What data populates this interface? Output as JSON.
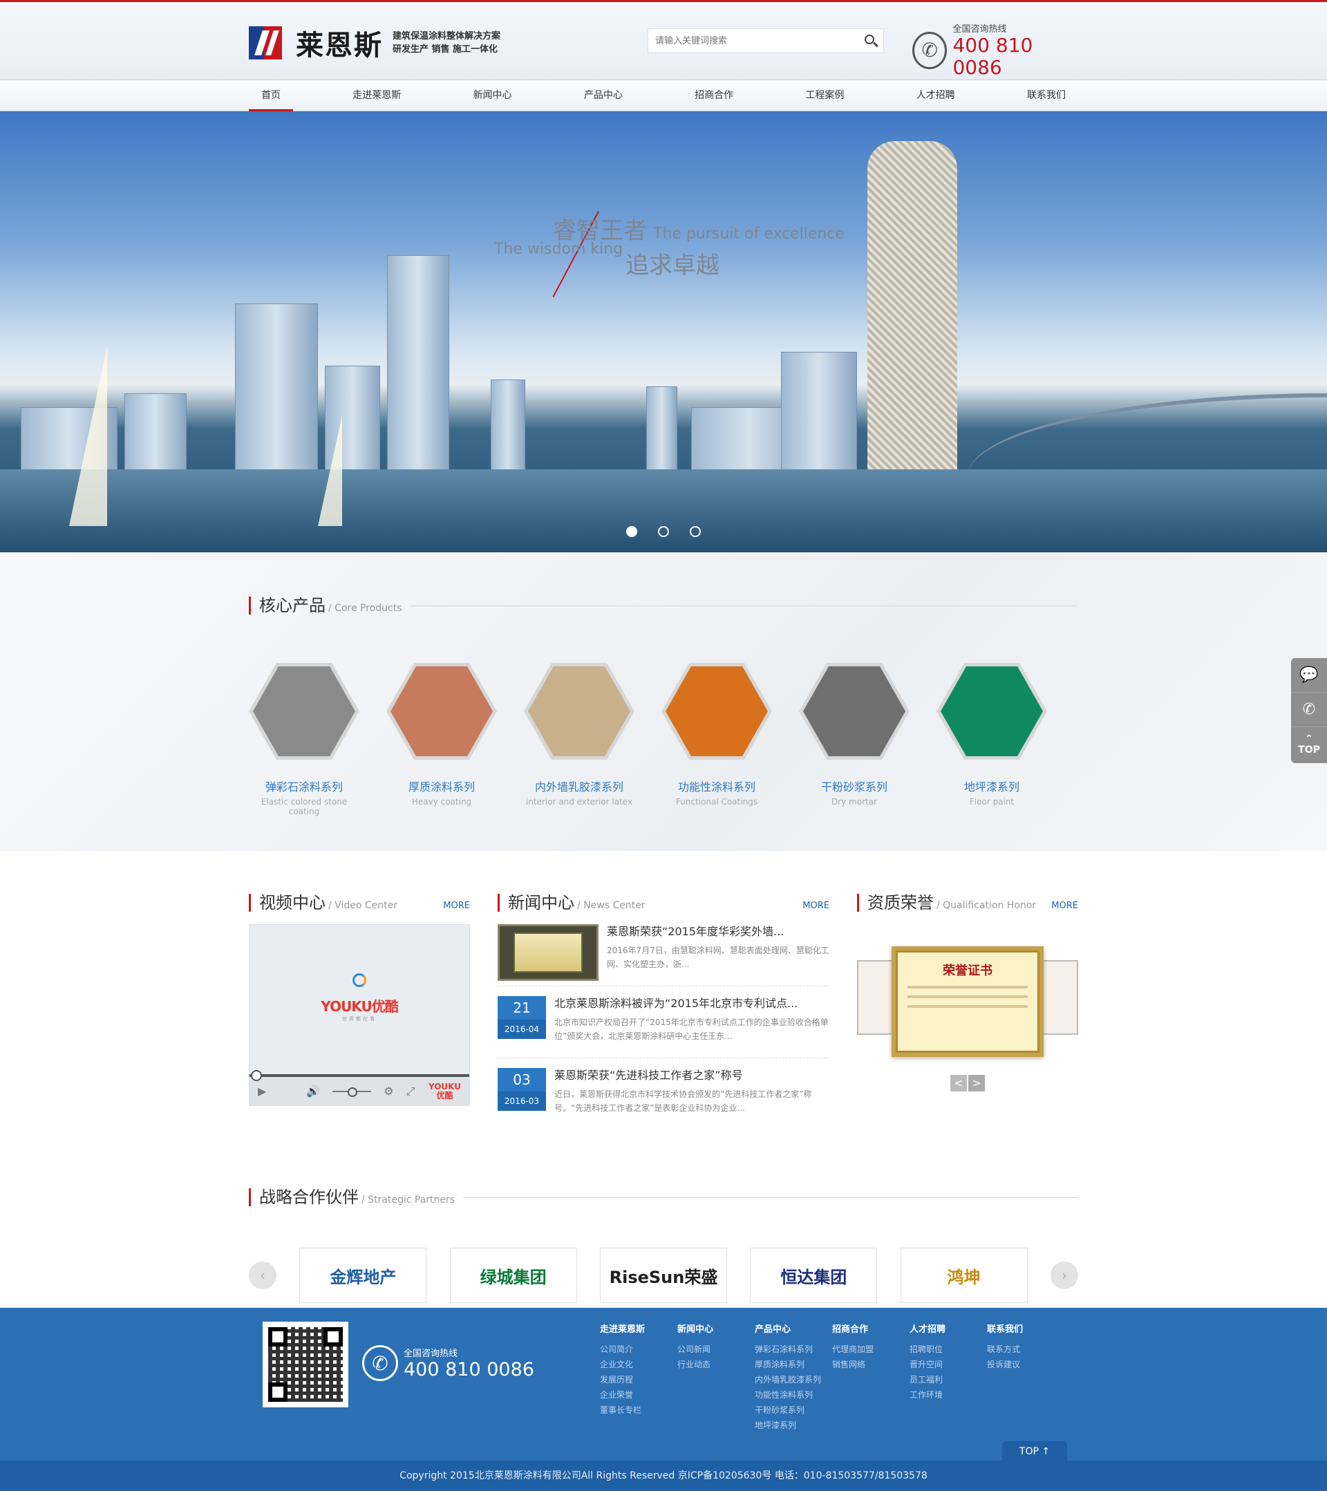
{
  "header": {
    "logo_name": "莱恩斯",
    "logo_tag_line1": "建筑保温涂料整体解决方案",
    "logo_tag_line2": "研发生产  销售  施工一体化",
    "search_placeholder": "请输入关键词搜索",
    "hotline_label": "全国咨询热线",
    "hotline_number": "400 810 0086"
  },
  "nav": {
    "items": [
      {
        "label": "首页",
        "active": true
      },
      {
        "label": "走进莱恩斯"
      },
      {
        "label": "新闻中心"
      },
      {
        "label": "产品中心"
      },
      {
        "label": "招商合作"
      },
      {
        "label": "工程案例"
      },
      {
        "label": "人才招聘"
      },
      {
        "label": "联系我们"
      }
    ]
  },
  "banner": {
    "title_cn_1": "睿智王者",
    "title_en_1": "The wisdom king",
    "title_en_2": "The pursuit of excellence",
    "title_cn_2": "追求卓越"
  },
  "core": {
    "title": "核心产品",
    "subtitle": "/ Core Products",
    "products": [
      {
        "cn": "弹彩石涂料系列",
        "en": "Elastic colored stone coating",
        "color": "#8a8a8a"
      },
      {
        "cn": "厚质涂料系列",
        "en": "Heavy coating",
        "color": "#c77a5c"
      },
      {
        "cn": "内外墙乳胶漆系列",
        "en": "interior and exterior latex",
        "color": "#c9b08c"
      },
      {
        "cn": "功能性涂料系列",
        "en": "Functional Coatings",
        "color": "#d7711c"
      },
      {
        "cn": "干粉砂浆系列",
        "en": "Dry mortar",
        "color": "#6f6f6f"
      },
      {
        "cn": "地坪漆系列",
        "en": "Floor paint",
        "color": "#0f8a60"
      }
    ]
  },
  "video": {
    "title": "视频中心",
    "subtitle": "/ Video Center",
    "more": "MORE",
    "player_logo": "YOUKU优酷",
    "player_sub": "世界都在看",
    "mini_logo_1": "YOUKU",
    "mini_logo_2": "优酷"
  },
  "news": {
    "title": "新闻中心",
    "subtitle": "/ News Center",
    "more": "MORE",
    "items": [
      {
        "title": "莱恩斯荣获“2015年度华彩奖外墙...",
        "desc": "2016年7月7日，由慧聪涂料网、慧聪表面处理网、慧聪化工网、实化塑主办，浙..."
      },
      {
        "day": "21",
        "ym": "2016-04",
        "title": "北京莱恩斯涂料被评为“2015年北京市专利试点...",
        "desc": "北京市知识产权局召开了“2015年北京市专利试点工作的企事业验收合格单位”颁奖大会，北京莱恩斯涂料研中心主任王东..."
      },
      {
        "day": "03",
        "ym": "2016-03",
        "title": "莱恩斯荣获“先进科技工作者之家”称号",
        "desc": "近日，莱恩斯获得北京市科学技术协会颁发的“先进科技工作者之家”称号。“先进科技工作者之家”是表彰企业科协为企业..."
      }
    ]
  },
  "honor": {
    "title": "资质荣誉",
    "subtitle": "/ Qualification Honor",
    "more": "MORE",
    "cert_title": "荣誉证书",
    "prev": "<",
    "next": ">"
  },
  "partners": {
    "title": "战略合作伙伴",
    "subtitle": "/ Strategic Partners",
    "logos": [
      {
        "name": "金辉地产",
        "color": "#1f5fa3"
      },
      {
        "name": "绿城集团",
        "color": "#0a7a3a"
      },
      {
        "name": "RiseSun荣盛",
        "color": "#222222"
      },
      {
        "name": "恒达集团",
        "color": "#1c2f7a"
      },
      {
        "name": "鸿坤",
        "color": "#c98a10"
      }
    ],
    "prev": "‹",
    "next": "›"
  },
  "footer": {
    "hotline_label": "全国咨询热线",
    "hotline_number": "400 810 0086",
    "columns": [
      {
        "title": "走进莱恩斯",
        "links": [
          "公司简介",
          "企业文化",
          "发展历程",
          "企业荣誉",
          "董事长专栏"
        ]
      },
      {
        "title": "新闻中心",
        "links": [
          "公司新闻",
          "行业动态"
        ]
      },
      {
        "title": "产品中心",
        "links": [
          "弹彩石涂料系列",
          "厚质涂料系列",
          "内外墙乳胶漆系列",
          "功能性涂料系列",
          "干粉砂浆系列",
          "地坪漆系列"
        ]
      },
      {
        "title": "招商合作",
        "links": [
          "代理商加盟",
          "销售网络"
        ]
      },
      {
        "title": "人才招聘",
        "links": [
          "招聘职位",
          "晋升空间",
          "员工福利",
          "工作环境"
        ]
      },
      {
        "title": "联系我们",
        "links": [
          "联系方式",
          "投诉建议"
        ]
      }
    ],
    "top_label": "TOP ↑",
    "copyright": "Copyright 2015北京莱恩斯涂料有限公司All Rights Reserved   京ICP备10205630号   电话：010-81503577/81503578"
  },
  "float_bar": {
    "top_label": "TOP"
  }
}
